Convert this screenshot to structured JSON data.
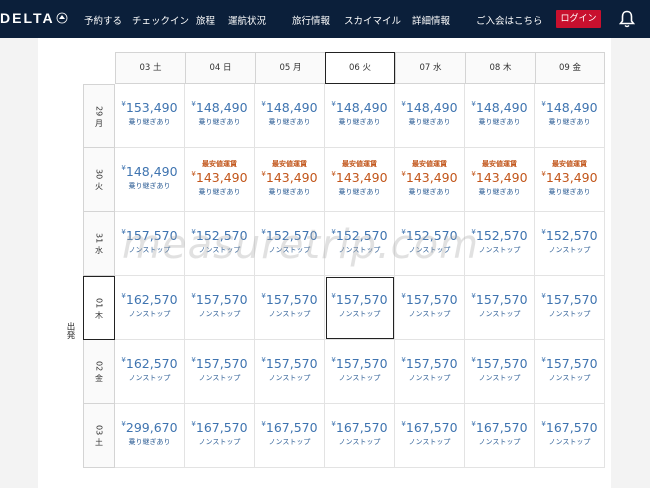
{
  "header": {
    "logo": "DELTA",
    "nav_left": [
      "予約する",
      "チェックイン",
      "旅程",
      "運航状況"
    ],
    "nav_right": [
      "旅行情報",
      "スカイマイル",
      "詳細情報"
    ],
    "greeting": "ご入会はこちら",
    "login": "ログイン"
  },
  "grid": {
    "depart_axis_label": "出発",
    "return_dates": [
      "03 土",
      "04 日",
      "05 月",
      "06 火",
      "07 水",
      "08 木",
      "09 金"
    ],
    "selected_return_index": 3,
    "selected_depart_index": 3,
    "rows": [
      {
        "depart": "29 月",
        "cells": [
          {
            "tag": "",
            "yen": "¥",
            "price": "153,490",
            "note": "乗り継ぎあり"
          },
          {
            "tag": "",
            "yen": "¥",
            "price": "148,490",
            "note": "乗り継ぎあり"
          },
          {
            "tag": "",
            "yen": "¥",
            "price": "148,490",
            "note": "乗り継ぎあり"
          },
          {
            "tag": "",
            "yen": "¥",
            "price": "148,490",
            "note": "乗り継ぎあり"
          },
          {
            "tag": "",
            "yen": "¥",
            "price": "148,490",
            "note": "乗り継ぎあり"
          },
          {
            "tag": "",
            "yen": "¥",
            "price": "148,490",
            "note": "乗り継ぎあり"
          },
          {
            "tag": "",
            "yen": "¥",
            "price": "148,490",
            "note": "乗り継ぎあり"
          }
        ]
      },
      {
        "depart": "30 火",
        "cells": [
          {
            "tag": "",
            "yen": "¥",
            "price": "148,490",
            "note": "乗り継ぎあり"
          },
          {
            "tag": "最安値運賃",
            "yen": "¥",
            "price": "143,490",
            "note": "乗り継ぎあり"
          },
          {
            "tag": "最安値運賃",
            "yen": "¥",
            "price": "143,490",
            "note": "乗り継ぎあり"
          },
          {
            "tag": "最安値運賃",
            "yen": "¥",
            "price": "143,490",
            "note": "乗り継ぎあり"
          },
          {
            "tag": "最安値運賃",
            "yen": "¥",
            "price": "143,490",
            "note": "乗り継ぎあり"
          },
          {
            "tag": "最安値運賃",
            "yen": "¥",
            "price": "143,490",
            "note": "乗り継ぎあり"
          },
          {
            "tag": "最安値運賃",
            "yen": "¥",
            "price": "143,490",
            "note": "乗り継ぎあり"
          }
        ]
      },
      {
        "depart": "31 水",
        "cells": [
          {
            "tag": "",
            "yen": "¥",
            "price": "157,570",
            "note": "ノンストップ"
          },
          {
            "tag": "",
            "yen": "¥",
            "price": "152,570",
            "note": "ノンストップ"
          },
          {
            "tag": "",
            "yen": "¥",
            "price": "152,570",
            "note": "ノンストップ"
          },
          {
            "tag": "",
            "yen": "¥",
            "price": "152,570",
            "note": "ノンストップ"
          },
          {
            "tag": "",
            "yen": "¥",
            "price": "152,570",
            "note": "ノンストップ"
          },
          {
            "tag": "",
            "yen": "¥",
            "price": "152,570",
            "note": "ノンストップ"
          },
          {
            "tag": "",
            "yen": "¥",
            "price": "152,570",
            "note": "ノンストップ"
          }
        ]
      },
      {
        "depart": "01 木",
        "cells": [
          {
            "tag": "",
            "yen": "¥",
            "price": "162,570",
            "note": "ノンストップ"
          },
          {
            "tag": "",
            "yen": "¥",
            "price": "157,570",
            "note": "ノンストップ"
          },
          {
            "tag": "",
            "yen": "¥",
            "price": "157,570",
            "note": "ノンストップ"
          },
          {
            "tag": "",
            "yen": "¥",
            "price": "157,570",
            "note": "ノンストップ"
          },
          {
            "tag": "",
            "yen": "¥",
            "price": "157,570",
            "note": "ノンストップ"
          },
          {
            "tag": "",
            "yen": "¥",
            "price": "157,570",
            "note": "ノンストップ"
          },
          {
            "tag": "",
            "yen": "¥",
            "price": "157,570",
            "note": "ノンストップ"
          }
        ]
      },
      {
        "depart": "02 金",
        "cells": [
          {
            "tag": "",
            "yen": "¥",
            "price": "162,570",
            "note": "ノンストップ"
          },
          {
            "tag": "",
            "yen": "¥",
            "price": "157,570",
            "note": "ノンストップ"
          },
          {
            "tag": "",
            "yen": "¥",
            "price": "157,570",
            "note": "ノンストップ"
          },
          {
            "tag": "",
            "yen": "¥",
            "price": "157,570",
            "note": "ノンストップ"
          },
          {
            "tag": "",
            "yen": "¥",
            "price": "157,570",
            "note": "ノンストップ"
          },
          {
            "tag": "",
            "yen": "¥",
            "price": "157,570",
            "note": "ノンストップ"
          },
          {
            "tag": "",
            "yen": "¥",
            "price": "157,570",
            "note": "ノンストップ"
          }
        ]
      },
      {
        "depart": "03 土",
        "cells": [
          {
            "tag": "",
            "yen": "¥",
            "price": "299,670",
            "note": "乗り継ぎあり"
          },
          {
            "tag": "",
            "yen": "¥",
            "price": "167,570",
            "note": "ノンストップ"
          },
          {
            "tag": "",
            "yen": "¥",
            "price": "167,570",
            "note": "ノンストップ"
          },
          {
            "tag": "",
            "yen": "¥",
            "price": "167,570",
            "note": "ノンストップ"
          },
          {
            "tag": "",
            "yen": "¥",
            "price": "167,570",
            "note": "ノンストップ"
          },
          {
            "tag": "",
            "yen": "¥",
            "price": "167,570",
            "note": "ノンストップ"
          },
          {
            "tag": "",
            "yen": "¥",
            "price": "167,570",
            "note": "ノンストップ"
          }
        ]
      }
    ]
  },
  "watermark": "measuretrip.com",
  "colors": {
    "nav_bg": "#0b1f3a",
    "login_bg": "#c8102e",
    "price": "#3f74b0",
    "cheapest": "#c2561b"
  }
}
